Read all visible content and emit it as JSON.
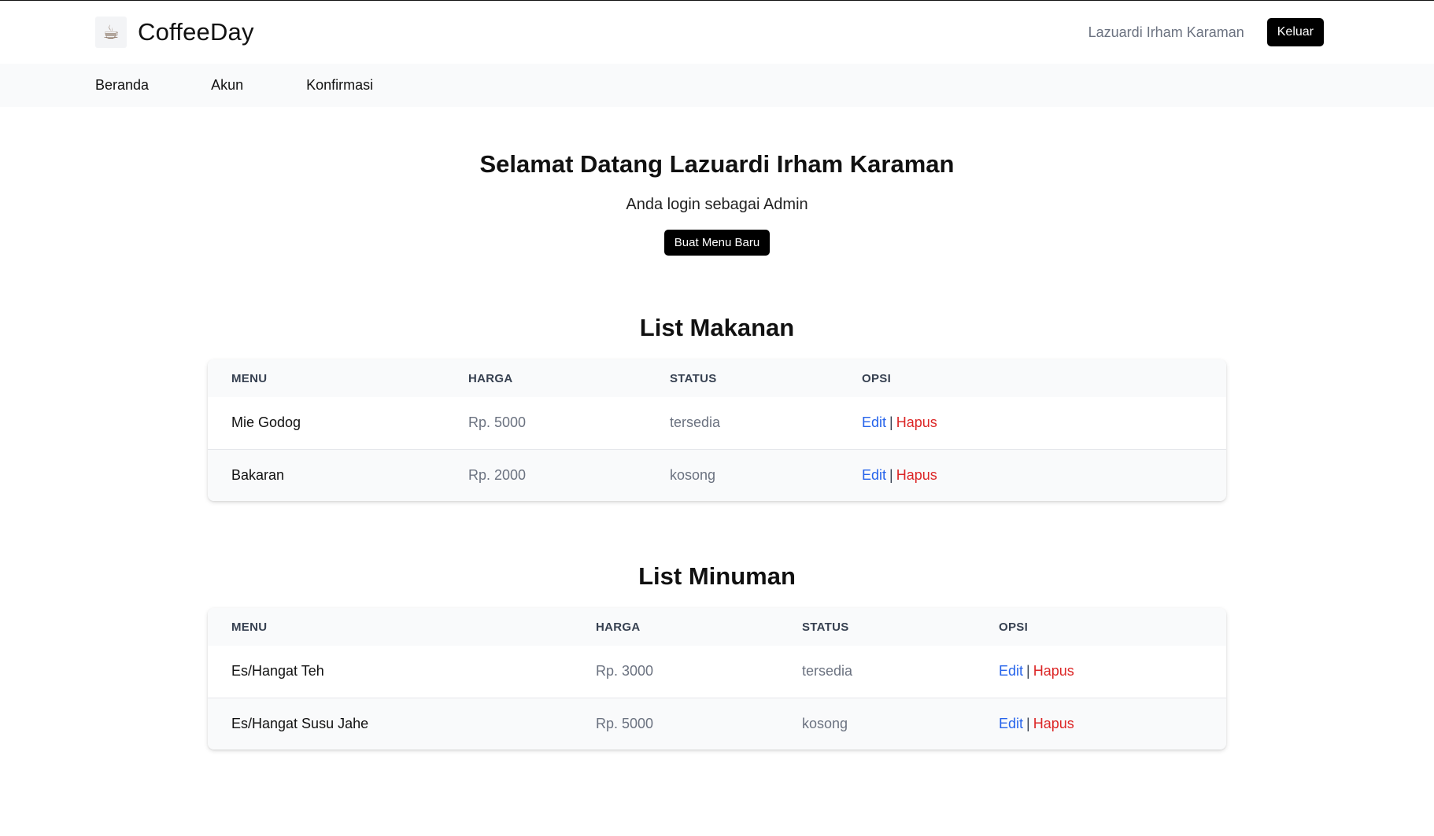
{
  "app": {
    "name": "CoffeeDay",
    "logo_icon": "coffee-cup-icon",
    "user_name": "Lazuardi Irham Karaman",
    "logout_label": "Keluar"
  },
  "nav": {
    "items": [
      {
        "label": "Beranda"
      },
      {
        "label": "Akun"
      },
      {
        "label": "Konfirmasi"
      }
    ]
  },
  "welcome": {
    "title": "Selamat Datang Lazuardi Irham Karaman",
    "subtitle": "Anda login sebagai Admin",
    "create_button": "Buat Menu Baru"
  },
  "colors": {
    "edit_link": "#2563eb",
    "delete_link": "#dc2626",
    "button_bg": "#000000"
  },
  "food": {
    "title": "List Makanan",
    "headers": {
      "menu": "MENU",
      "harga": "HARGA",
      "status": "STATUS",
      "opsi": "OPSI"
    },
    "rows": [
      {
        "menu": "Mie Godog",
        "harga": "Rp. 5000",
        "status": "tersedia",
        "edit": "Edit",
        "sep": "|",
        "delete": "Hapus"
      },
      {
        "menu": "Bakaran",
        "harga": "Rp. 2000",
        "status": "kosong",
        "edit": "Edit",
        "sep": "|",
        "delete": "Hapus"
      }
    ]
  },
  "drinks": {
    "title": "List Minuman",
    "headers": {
      "menu": "MENU",
      "harga": "HARGA",
      "status": "STATUS",
      "opsi": "OPSI"
    },
    "rows": [
      {
        "menu": "Es/Hangat Teh",
        "harga": "Rp. 3000",
        "status": "tersedia",
        "edit": "Edit",
        "sep": "|",
        "delete": "Hapus"
      },
      {
        "menu": "Es/Hangat Susu Jahe",
        "harga": "Rp. 5000",
        "status": "kosong",
        "edit": "Edit",
        "sep": "|",
        "delete": "Hapus"
      }
    ]
  }
}
